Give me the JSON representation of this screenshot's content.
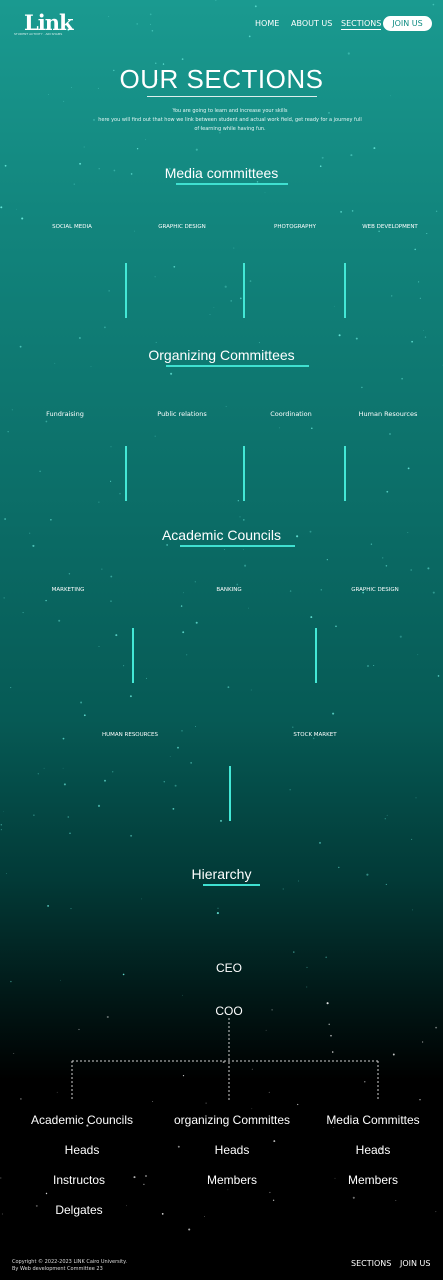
{
  "nav": {
    "logo_text": "Link",
    "logo_tagline": "STUDENT ACTIVITY · AIN SHAMS",
    "links": [
      {
        "label": "HOME"
      },
      {
        "label": "ABOUT US"
      },
      {
        "label": "SECTIONS"
      }
    ],
    "join_label": "JOIN US"
  },
  "header": {
    "title": "OUR SECTIONS",
    "intro_lines": [
      "You are going to learn and increase your skills",
      "here you will find out that how we link between student and actual work field, get ready for a journey full",
      "of learning while having fun."
    ]
  },
  "sections": [
    {
      "title": "Media committees",
      "items": [
        "SOCIAL MEDIA",
        "GRAPHIC DESIGN",
        "PHOTOGRAPHY",
        "WEB DEVELOPMENT"
      ]
    },
    {
      "title": "Organizing Committees",
      "items": [
        "Fundraising",
        "Public relations",
        "Coordination",
        "Human Resources"
      ]
    },
    {
      "title": "Academic Councils",
      "items": [
        "MARKETING",
        "BANKING",
        "GRAPHIC DESIGN",
        "HUMAN RESOURCES",
        "STOCK MARKET"
      ]
    }
  ],
  "hierarchy": {
    "title": "Hierarchy",
    "ceo": "CEO",
    "coo": "COO",
    "columns": [
      {
        "title": "Academic Councils",
        "rows": [
          "Heads",
          "Instructos",
          "Delgates"
        ]
      },
      {
        "title": "organizing Committes",
        "rows": [
          "Heads",
          "Members"
        ]
      },
      {
        "title": "Media  Committes",
        "rows": [
          "Heads",
          "Members"
        ]
      }
    ]
  },
  "footer": {
    "copyright": "Copyright © 2022-2023 LINK Cairo University.",
    "credit": "By Web development Committee 23",
    "links": [
      "SECTIONS",
      "JOIN US"
    ]
  },
  "colors": {
    "accent": "#43e8d6",
    "gradient_top": "#1a9a90",
    "gradient_bottom": "#000000"
  }
}
